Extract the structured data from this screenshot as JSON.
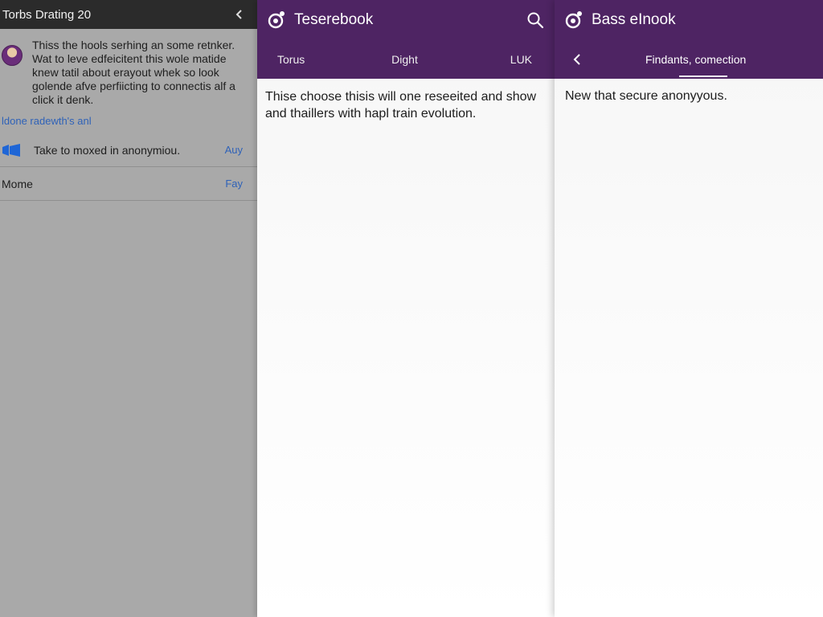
{
  "left_panel": {
    "title": "Torbs Drating 20",
    "message": "Thiss the hools serhing an some retnker. Wat to leve edfeicitent this wole matide knew tatil about erayout whek so look golende afve perfiicting to connectis alf a click it denk.",
    "link": "ldone radewth's anl",
    "rows": [
      {
        "label": "Take to moxed in anonymiou.",
        "action": "Auy",
        "icon": "windows-icon"
      },
      {
        "label": "Mome",
        "action": "Fay"
      }
    ],
    "colors": {
      "header_bg": "#2b2b2b",
      "dim_bg": "#a9a9a9",
      "link": "#2f62b8"
    }
  },
  "middle_panel": {
    "title": "Teserebook",
    "tabs": [
      "Torus",
      "Dight",
      "LUK"
    ],
    "content": "Thise choose thisis will one reseeited and show and thaillers with hapl train evolution.",
    "icons": {
      "logo": "app-logo-icon",
      "search": "search-icon"
    }
  },
  "right_panel": {
    "title": "Bass eInook",
    "sub_label": "Findants, comection",
    "content": "New that secure anonyyous.",
    "icons": {
      "logo": "app-logo-icon",
      "back": "chevron-left-icon"
    }
  },
  "theme": {
    "accent": "#4e2463",
    "content_bg": "#f6f6f6"
  }
}
